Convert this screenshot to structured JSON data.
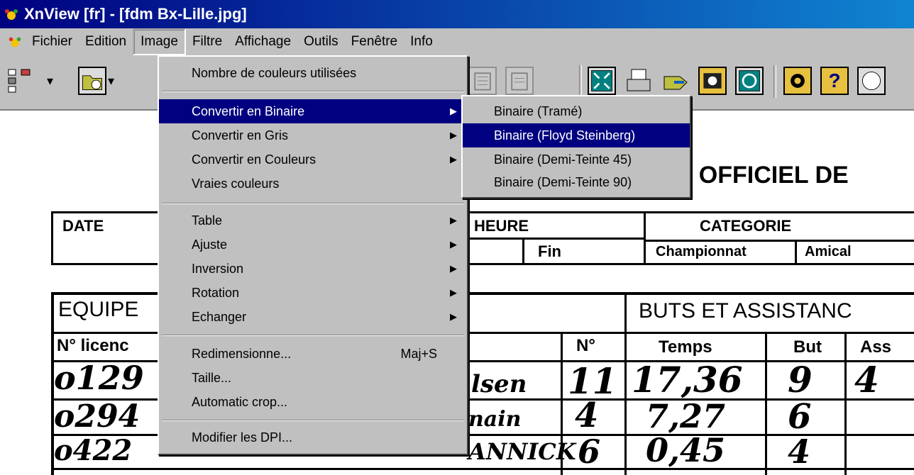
{
  "titlebar": {
    "text": "XnView [fr] - [fdm Bx-Lille.jpg]"
  },
  "menubar": {
    "items": [
      {
        "label": "Fichier"
      },
      {
        "label": "Edition"
      },
      {
        "label": "Image"
      },
      {
        "label": "Filtre"
      },
      {
        "label": "Affichage"
      },
      {
        "label": "Outils"
      },
      {
        "label": "Fenêtre"
      },
      {
        "label": "Info"
      }
    ]
  },
  "image_menu": {
    "items": [
      {
        "label": "Nombre de couleurs utilisées"
      },
      {
        "label": "Convertir en Binaire",
        "submenu": true
      },
      {
        "label": "Convertir en Gris",
        "submenu": true
      },
      {
        "label": "Convertir en Couleurs",
        "submenu": true
      },
      {
        "label": "Vraies couleurs"
      },
      {
        "label": "Table",
        "submenu": true
      },
      {
        "label": "Ajuste",
        "submenu": true
      },
      {
        "label": "Inversion",
        "submenu": true
      },
      {
        "label": "Rotation",
        "submenu": true
      },
      {
        "label": "Echanger",
        "submenu": true
      },
      {
        "label": "Redimensionne...",
        "shortcut": "Maj+S"
      },
      {
        "label": "Taille..."
      },
      {
        "label": "Automatic crop..."
      },
      {
        "label": "Modifier les DPI..."
      }
    ]
  },
  "binaire_submenu": {
    "items": [
      {
        "label": "Binaire (Tramé)"
      },
      {
        "label": "Binaire (Floyd Steinberg)"
      },
      {
        "label": "Binaire (Demi-Teinte 45)"
      },
      {
        "label": "Binaire (Demi-Teinte 90)"
      }
    ]
  },
  "document": {
    "heading": "RT OFFICIEL DE",
    "date_label": "DATE",
    "heure_label": "HEURE",
    "fin_label": "Fin",
    "categorie_label": "CATEGORIE",
    "championnat_label": "Championnat",
    "amical_label": "Amical",
    "equipe_label": "EQUIPE",
    "licence_label": "N° licenc",
    "numero_label": "N°",
    "buts_label": "BUTS ET ASSISTANC",
    "temps_label": "Temps",
    "but_label": "But",
    "ass_label": "Ass",
    "hand_rows": [
      {
        "licence": "o129",
        "name": "lsen",
        "num": "11",
        "temps": "17,36",
        "but": "9",
        "ass": "4"
      },
      {
        "licence": "o294",
        "name": "nain",
        "num": "4",
        "temps": "7,27",
        "but": "6",
        "ass": ""
      },
      {
        "licence": "o422",
        "name": "ANNICK",
        "num": "6",
        "temps": "0,45",
        "but": "4",
        "ass": ""
      }
    ]
  },
  "colors": {
    "highlight": "#000080",
    "face": "#c0c0c0"
  }
}
